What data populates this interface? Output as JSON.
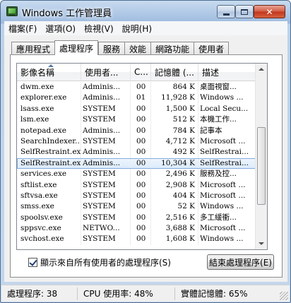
{
  "window": {
    "title": "Windows 工作管理員",
    "icons": {
      "app": "task-manager-icon",
      "minimize": "minimize-icon",
      "maximize": "maximize-icon",
      "close": "close-icon"
    },
    "close_glyph": "✕"
  },
  "menu": [
    {
      "label": "檔案(F)"
    },
    {
      "label": "選項(O)"
    },
    {
      "label": "檢視(V)"
    },
    {
      "label": "說明(H)"
    }
  ],
  "tabs": [
    {
      "label": "應用程式",
      "active": false
    },
    {
      "label": "處理程序",
      "active": true
    },
    {
      "label": "服務",
      "active": false
    },
    {
      "label": "效能",
      "active": false
    },
    {
      "label": "網路功能",
      "active": false
    },
    {
      "label": "使用者",
      "active": false
    }
  ],
  "columns": {
    "name": "影像名稱",
    "user": "使用者...",
    "cpu": "C...",
    "memory": "記憶體 (...",
    "description": "描述"
  },
  "processes": [
    {
      "name": "dwm.exe",
      "user": "Adminis...",
      "cpu": "00",
      "memory": "864 K",
      "description": "桌面視窗..."
    },
    {
      "name": "explorer.exe",
      "user": "Adminis...",
      "cpu": "01",
      "memory": "11,928 K",
      "description": "Windows ..."
    },
    {
      "name": "lsass.exe",
      "user": "SYSTEM",
      "cpu": "00",
      "memory": "1,500 K",
      "description": "Local Secu..."
    },
    {
      "name": "lsm.exe",
      "user": "SYSTEM",
      "cpu": "00",
      "memory": "512 K",
      "description": "本機工作..."
    },
    {
      "name": "notepad.exe",
      "user": "Adminis...",
      "cpu": "00",
      "memory": "784 K",
      "description": "記事本"
    },
    {
      "name": "SearchIndexer...",
      "user": "SYSTEM",
      "cpu": "00",
      "memory": "4,712 K",
      "description": "Microsoft ..."
    },
    {
      "name": "SelfRestraint.exe",
      "user": "Adminis...",
      "cpu": "00",
      "memory": "492 K",
      "description": "SelfRestrai..."
    },
    {
      "name": "SelfRestraint.exe",
      "user": "Adminis...",
      "cpu": "00",
      "memory": "10,304 K",
      "description": "SelfRestrai...",
      "selected": true
    },
    {
      "name": "services.exe",
      "user": "SYSTEM",
      "cpu": "00",
      "memory": "2,496 K",
      "description": "服務及控..."
    },
    {
      "name": "sftlist.exe",
      "user": "SYSTEM",
      "cpu": "00",
      "memory": "2,908 K",
      "description": "Microsoft ..."
    },
    {
      "name": "sftvsa.exe",
      "user": "SYSTEM",
      "cpu": "00",
      "memory": "404 K",
      "description": "Microsoft ..."
    },
    {
      "name": "smss.exe",
      "user": "SYSTEM",
      "cpu": "00",
      "memory": "52 K",
      "description": "Windows ..."
    },
    {
      "name": "spoolsv.exe",
      "user": "SYSTEM",
      "cpu": "00",
      "memory": "2,516 K",
      "description": "多工緩衝..."
    },
    {
      "name": "sppsvc.exe",
      "user": "NETWO...",
      "cpu": "00",
      "memory": "3,688 K",
      "description": "Microsoft ..."
    },
    {
      "name": "svchost.exe",
      "user": "SYSTEM",
      "cpu": "00",
      "memory": "1,608 K",
      "description": "Windows ..."
    }
  ],
  "show_all_users": {
    "label": "顯示來自所有使用者的處理程序(S)",
    "checked": true
  },
  "end_process_button": "結束處理程序(E)",
  "status": {
    "processes": "處理程序: 38",
    "cpu": "CPU 使用率: 48%",
    "memory": "實體記憶體: 65%"
  },
  "colors": {
    "selection": "#dbebfc",
    "title_gradient": "#9dbbdf",
    "close_button": "#c2361c"
  }
}
